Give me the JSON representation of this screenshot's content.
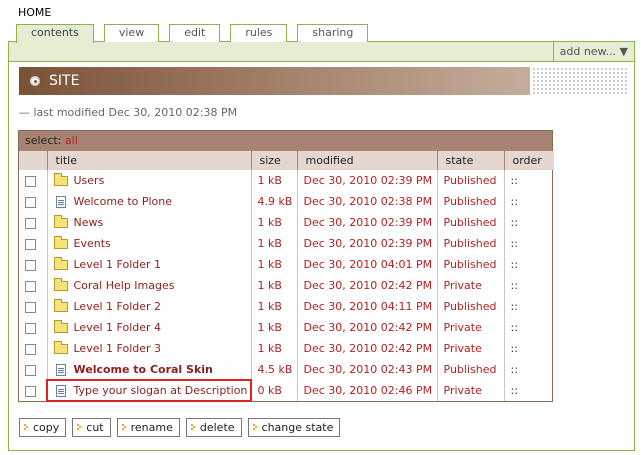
{
  "breadcrumb": "HOME",
  "tabs": [
    {
      "label": "contents",
      "active": true
    },
    {
      "label": "view"
    },
    {
      "label": "edit"
    },
    {
      "label": "rules"
    },
    {
      "label": "sharing"
    }
  ],
  "add_new": "add new... ▼",
  "site_title": "SITE",
  "modified_text": "— last modified Dec 30, 2010 02:38 PM",
  "select_label": "select:",
  "select_all": "all",
  "columns": [
    "title",
    "size",
    "modified",
    "state",
    "order"
  ],
  "rows": [
    {
      "title": "Users",
      "type": "folder",
      "size": "1 kB",
      "modified": "Dec 30, 2010 02:39 PM",
      "state": "Published",
      "order": "::"
    },
    {
      "title": "Welcome to Plone",
      "type": "doc",
      "size": "4.9 kB",
      "modified": "Dec 30, 2010 02:38 PM",
      "state": "Published",
      "order": "::"
    },
    {
      "title": "News",
      "type": "folder",
      "size": "1 kB",
      "modified": "Dec 30, 2010 02:39 PM",
      "state": "Published",
      "order": "::"
    },
    {
      "title": "Events",
      "type": "folder",
      "size": "1 kB",
      "modified": "Dec 30, 2010 02:39 PM",
      "state": "Published",
      "order": "::"
    },
    {
      "title": "Level 1 Folder 1",
      "type": "folder",
      "size": "1 kB",
      "modified": "Dec 30, 2010 04:01 PM",
      "state": "Published",
      "order": "::"
    },
    {
      "title": "Coral Help Images",
      "type": "folder",
      "size": "1 kB",
      "modified": "Dec 30, 2010 02:42 PM",
      "state": "Private",
      "order": "::"
    },
    {
      "title": "Level 1 Folder 2",
      "type": "folder",
      "size": "1 kB",
      "modified": "Dec 30, 2010 04:11 PM",
      "state": "Published",
      "order": "::"
    },
    {
      "title": "Level 1 Folder 4",
      "type": "folder",
      "size": "1 kB",
      "modified": "Dec 30, 2010 02:42 PM",
      "state": "Private",
      "order": "::"
    },
    {
      "title": "Level 1 Folder 3",
      "type": "folder",
      "size": "1 kB",
      "modified": "Dec 30, 2010 02:42 PM",
      "state": "Private",
      "order": "::"
    },
    {
      "title": "Welcome to Coral Skin",
      "type": "doc",
      "bold": true,
      "size": "4.5 kB",
      "modified": "Dec 30, 2010 02:43 PM",
      "state": "Published",
      "order": "::"
    },
    {
      "title": "Type your slogan at Description",
      "type": "doc",
      "highlight": true,
      "size": "0 kB",
      "modified": "Dec 30, 2010 02:46 PM",
      "state": "Private",
      "order": "::"
    }
  ],
  "buttons": [
    "copy",
    "cut",
    "rename",
    "delete",
    "change state"
  ]
}
